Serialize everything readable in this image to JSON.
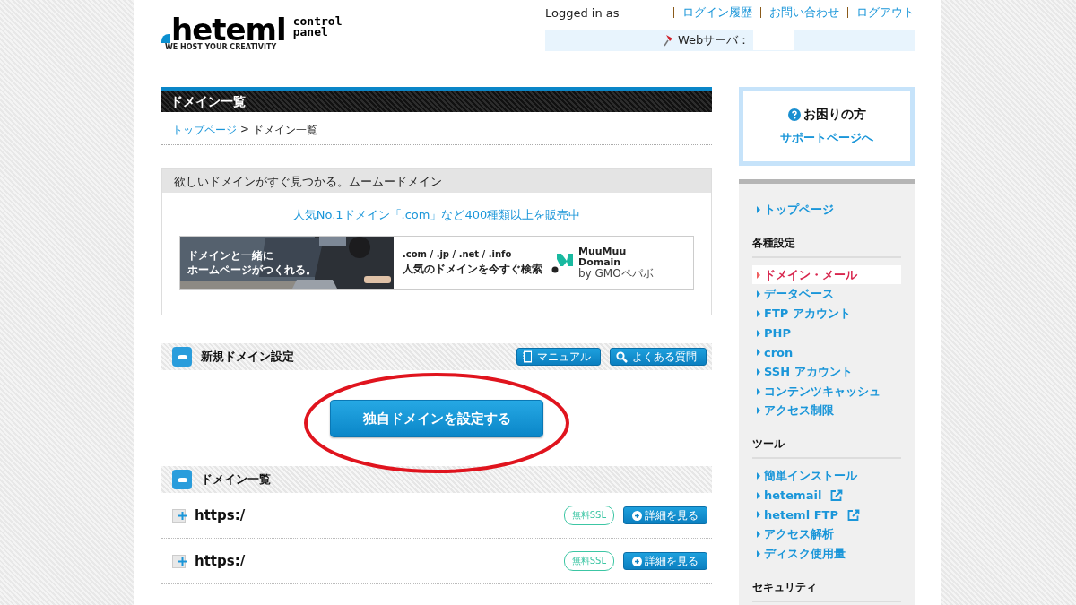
{
  "logo": {
    "wordmark": "heteml",
    "tagline": "WE HOST YOUR CREATIVITY",
    "subtitle_1": "control",
    "subtitle_2": "panel"
  },
  "header": {
    "logged_in": "Logged in as",
    "links": [
      "ログイン履歴",
      "お問い合わせ",
      "ログアウト"
    ],
    "server_label": "Webサーバ："
  },
  "page_title": "ドメイン一覧",
  "breadcrumb": {
    "links": [
      "トップページ"
    ],
    "separator": ">",
    "current": "ドメイン一覧"
  },
  "promo": {
    "title": "欲しいドメインがすぐ見つかる。ムームードメイン",
    "link": "人気No.1ドメイン「.com」など400種類以上を販売中",
    "banner": {
      "headline_1": "ドメインと一緒に",
      "headline_2": "ホームページがつくれる。",
      "tlds": ".com / .jp / .net / .info",
      "tagline": "人気のドメインを今すぐ検索",
      "brand_1": "MuuMuu",
      "brand_2": "Domain",
      "maker": "by GMOペパボ"
    }
  },
  "new_domain": {
    "title": "新規ドメイン設定",
    "buttons": [
      {
        "label": "マニュアル",
        "kind": "manual"
      },
      {
        "label": "よくある質問",
        "kind": "faq"
      }
    ],
    "primary_button": "独自ドメインを設定する",
    "annotated": true
  },
  "domain_list": {
    "title": "ドメイン一覧",
    "rows": [
      {
        "url": "https:/",
        "badge": "無料SSL",
        "action": "詳細を見る"
      },
      {
        "url": "https:/",
        "badge": "無料SSL",
        "action": "詳細を見る"
      }
    ]
  },
  "help": {
    "title": "お困りの方",
    "link": "サポートページへ"
  },
  "sidebar": {
    "sections": [
      {
        "items": [
          {
            "label": "トップページ",
            "selected": false,
            "external": false
          }
        ]
      },
      {
        "heading": "各種設定",
        "items": [
          {
            "label": "ドメイン・メール",
            "selected": true,
            "external": false
          },
          {
            "label": "データベース",
            "selected": false,
            "external": false
          },
          {
            "label": "FTP アカウント",
            "selected": false,
            "external": false
          },
          {
            "label": "PHP",
            "selected": false,
            "external": false
          },
          {
            "label": "cron",
            "selected": false,
            "external": false
          },
          {
            "label": "SSH アカウント",
            "selected": false,
            "external": false
          },
          {
            "label": "コンテンツキャッシュ",
            "selected": false,
            "external": false
          },
          {
            "label": "アクセス制限",
            "selected": false,
            "external": false
          }
        ]
      },
      {
        "heading": "ツール",
        "items": [
          {
            "label": "簡単インストール",
            "selected": false,
            "external": false
          },
          {
            "label": "hetemail",
            "selected": false,
            "external": true
          },
          {
            "label": "heteml FTP",
            "selected": false,
            "external": true
          },
          {
            "label": "アクセス解析",
            "selected": false,
            "external": false
          },
          {
            "label": "ディスク使用量",
            "selected": false,
            "external": false
          }
        ]
      },
      {
        "heading": "セキュリティ"
      }
    ]
  }
}
